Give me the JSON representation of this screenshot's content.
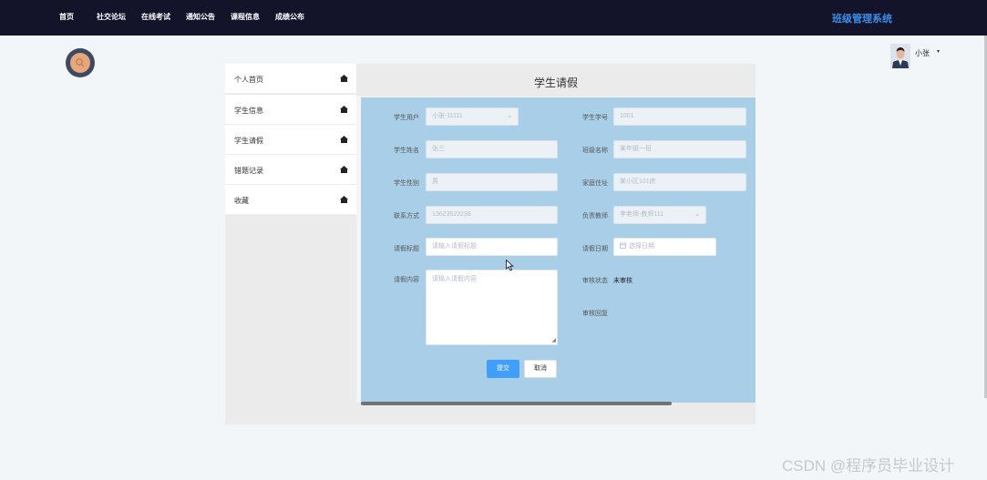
{
  "nav": {
    "items": [
      {
        "label": "首页"
      },
      {
        "label": "社交论坛"
      },
      {
        "label": "在线考试"
      },
      {
        "label": "通知公告"
      },
      {
        "label": "课程信息"
      },
      {
        "label": "成绩公布"
      }
    ],
    "brand": "班级管理系统"
  },
  "user": {
    "name": "小张",
    "caret": "▾"
  },
  "sidebar": {
    "items": [
      {
        "label": "个人首页",
        "icon": "home-icon"
      },
      {
        "label": "学生信息",
        "icon": "home-icon"
      },
      {
        "label": "学生请假",
        "icon": "home-icon"
      },
      {
        "label": "错题记录",
        "icon": "home-icon"
      },
      {
        "label": "收藏",
        "icon": "home-icon"
      }
    ]
  },
  "page": {
    "title": "学生请假"
  },
  "form": {
    "student_user": {
      "label": "学生用户",
      "value": "小张-11111"
    },
    "student_no": {
      "label": "学生学号",
      "value": "1001"
    },
    "student_name": {
      "label": "学生姓名",
      "value": "张三"
    },
    "class_name": {
      "label": "班级名称",
      "value": "某年级一班"
    },
    "gender": {
      "label": "学生性别",
      "value": "男"
    },
    "address": {
      "label": "家庭住址",
      "value": "某小区101房"
    },
    "phone": {
      "label": "联系方式",
      "value": "13623523238"
    },
    "teacher": {
      "label": "负责教师",
      "value": "李老师-教师111"
    },
    "leave_title": {
      "label": "请假标题",
      "placeholder": "请输入请假标题"
    },
    "leave_date": {
      "label": "请假日期",
      "placeholder": "选择日期"
    },
    "leave_content": {
      "label": "请假内容",
      "placeholder": "请输入请假内容"
    },
    "review_status": {
      "label": "审核状态",
      "value": "未审核"
    },
    "review_reply": {
      "label": "审核回复"
    }
  },
  "buttons": {
    "submit": "提交",
    "cancel": "取消"
  },
  "watermark": "CSDN @程序员毕业设计",
  "colors": {
    "topbar": "#13142a",
    "brand": "#3a8de8",
    "form_bg": "#a9cfe8",
    "primary": "#409eff"
  }
}
